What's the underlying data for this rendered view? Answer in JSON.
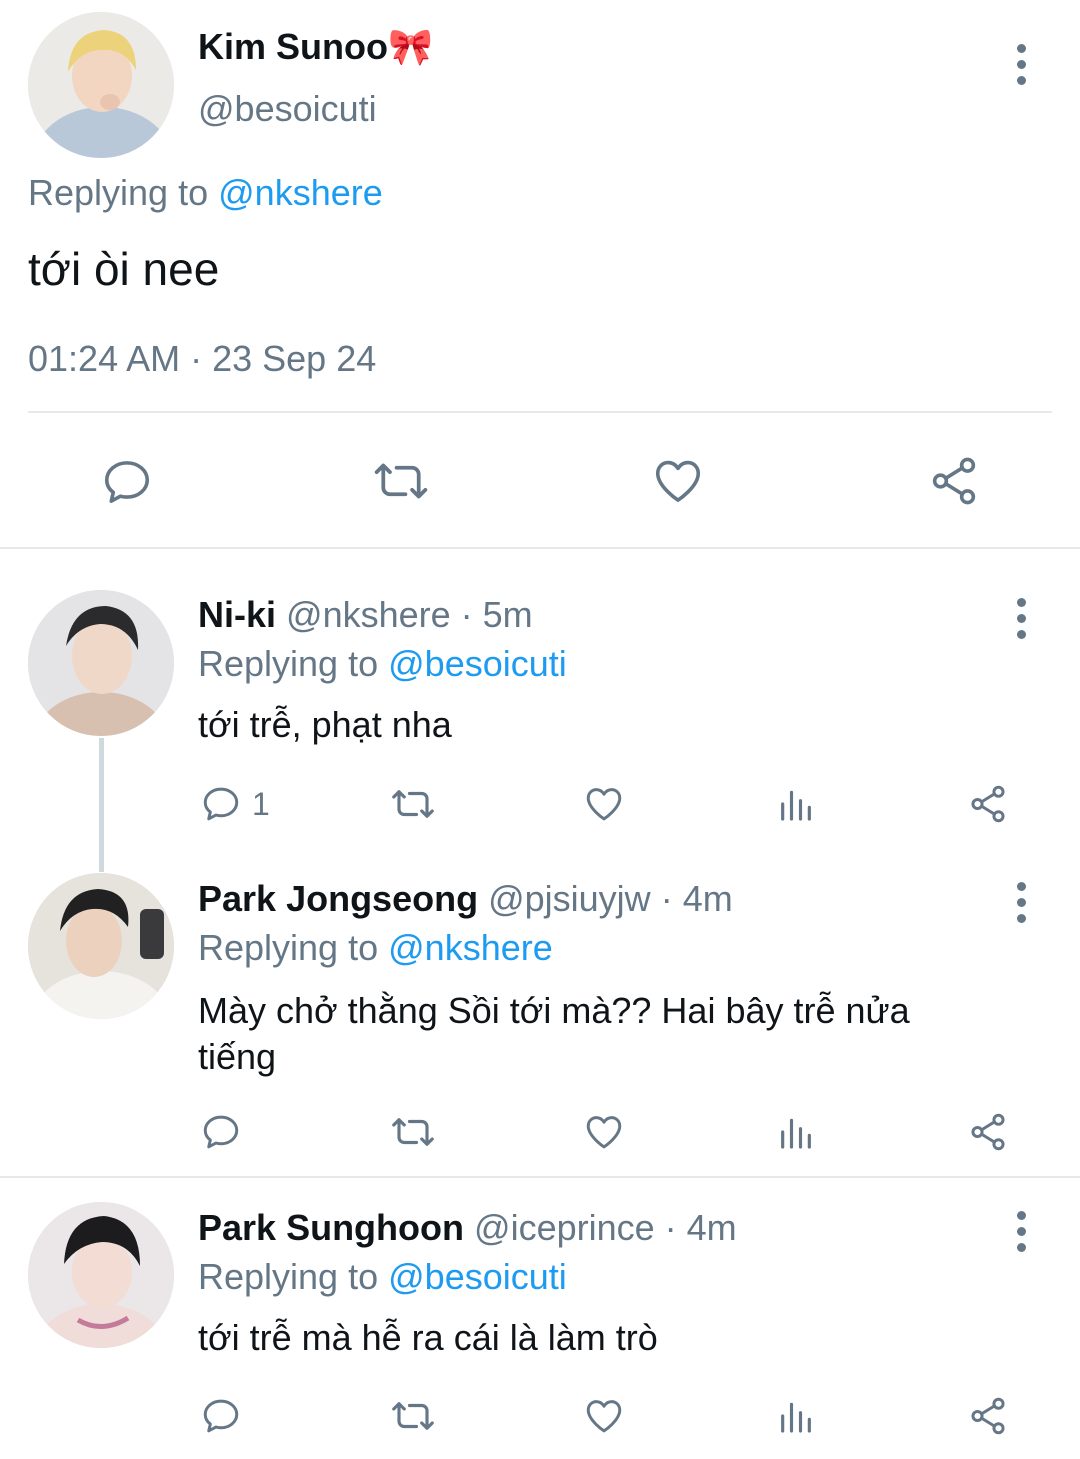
{
  "main_tweet": {
    "display_name": "Kim Sunoo",
    "name_emoji": "🎀",
    "handle": "@besoicuti",
    "replying_prefix": "Replying to",
    "replying_handle": "@nkshere",
    "text": "tới òi nee",
    "timestamp": "01:24 AM · 23 Sep 24"
  },
  "replies": [
    {
      "display_name": "Ni-ki",
      "handle": "@nkshere",
      "time": "· 5m",
      "replying_prefix": "Replying to",
      "replying_handle": "@besoicuti",
      "text": "tới trễ, phạt nha",
      "reply_count": "1"
    },
    {
      "display_name": "Park Jongseong",
      "handle": "@pjsiuyjw",
      "time": "· 4m",
      "replying_prefix": "Replying to",
      "replying_handle": "@nkshere",
      "text_line1": "Mày chở thằng Sồi tới mà?? Hai bây trễ nửa",
      "text_line2": "tiếng"
    },
    {
      "display_name": "Park Sunghoon",
      "handle": "@iceprince",
      "time": "· 4m",
      "replying_prefix": "Replying to",
      "replying_handle": "@besoicuti",
      "text": "tới trễ mà hễ ra cái là làm trò"
    }
  ],
  "icons": [
    "reply-icon",
    "retweet-icon",
    "like-icon",
    "share-icon",
    "analytics-icon",
    "more-icon"
  ],
  "colors": {
    "link": "#1d9bf0",
    "muted": "#657786",
    "text": "#0f1419",
    "divider": "#e6e9ec"
  }
}
